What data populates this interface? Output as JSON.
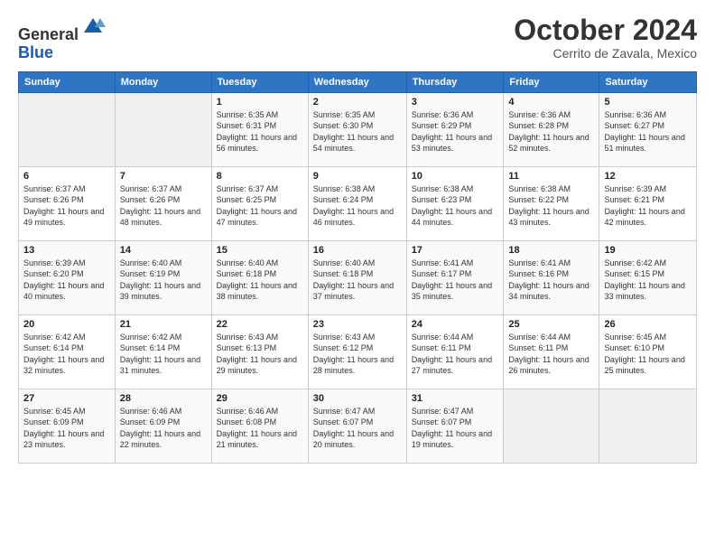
{
  "header": {
    "logo_line1": "General",
    "logo_line2": "Blue",
    "month": "October 2024",
    "location": "Cerrito de Zavala, Mexico"
  },
  "weekdays": [
    "Sunday",
    "Monday",
    "Tuesday",
    "Wednesday",
    "Thursday",
    "Friday",
    "Saturday"
  ],
  "weeks": [
    [
      {
        "day": "",
        "info": ""
      },
      {
        "day": "",
        "info": ""
      },
      {
        "day": "1",
        "info": "Sunrise: 6:35 AM\nSunset: 6:31 PM\nDaylight: 11 hours and 56 minutes."
      },
      {
        "day": "2",
        "info": "Sunrise: 6:35 AM\nSunset: 6:30 PM\nDaylight: 11 hours and 54 minutes."
      },
      {
        "day": "3",
        "info": "Sunrise: 6:36 AM\nSunset: 6:29 PM\nDaylight: 11 hours and 53 minutes."
      },
      {
        "day": "4",
        "info": "Sunrise: 6:36 AM\nSunset: 6:28 PM\nDaylight: 11 hours and 52 minutes."
      },
      {
        "day": "5",
        "info": "Sunrise: 6:36 AM\nSunset: 6:27 PM\nDaylight: 11 hours and 51 minutes."
      }
    ],
    [
      {
        "day": "6",
        "info": "Sunrise: 6:37 AM\nSunset: 6:26 PM\nDaylight: 11 hours and 49 minutes."
      },
      {
        "day": "7",
        "info": "Sunrise: 6:37 AM\nSunset: 6:26 PM\nDaylight: 11 hours and 48 minutes."
      },
      {
        "day": "8",
        "info": "Sunrise: 6:37 AM\nSunset: 6:25 PM\nDaylight: 11 hours and 47 minutes."
      },
      {
        "day": "9",
        "info": "Sunrise: 6:38 AM\nSunset: 6:24 PM\nDaylight: 11 hours and 46 minutes."
      },
      {
        "day": "10",
        "info": "Sunrise: 6:38 AM\nSunset: 6:23 PM\nDaylight: 11 hours and 44 minutes."
      },
      {
        "day": "11",
        "info": "Sunrise: 6:38 AM\nSunset: 6:22 PM\nDaylight: 11 hours and 43 minutes."
      },
      {
        "day": "12",
        "info": "Sunrise: 6:39 AM\nSunset: 6:21 PM\nDaylight: 11 hours and 42 minutes."
      }
    ],
    [
      {
        "day": "13",
        "info": "Sunrise: 6:39 AM\nSunset: 6:20 PM\nDaylight: 11 hours and 40 minutes."
      },
      {
        "day": "14",
        "info": "Sunrise: 6:40 AM\nSunset: 6:19 PM\nDaylight: 11 hours and 39 minutes."
      },
      {
        "day": "15",
        "info": "Sunrise: 6:40 AM\nSunset: 6:18 PM\nDaylight: 11 hours and 38 minutes."
      },
      {
        "day": "16",
        "info": "Sunrise: 6:40 AM\nSunset: 6:18 PM\nDaylight: 11 hours and 37 minutes."
      },
      {
        "day": "17",
        "info": "Sunrise: 6:41 AM\nSunset: 6:17 PM\nDaylight: 11 hours and 35 minutes."
      },
      {
        "day": "18",
        "info": "Sunrise: 6:41 AM\nSunset: 6:16 PM\nDaylight: 11 hours and 34 minutes."
      },
      {
        "day": "19",
        "info": "Sunrise: 6:42 AM\nSunset: 6:15 PM\nDaylight: 11 hours and 33 minutes."
      }
    ],
    [
      {
        "day": "20",
        "info": "Sunrise: 6:42 AM\nSunset: 6:14 PM\nDaylight: 11 hours and 32 minutes."
      },
      {
        "day": "21",
        "info": "Sunrise: 6:42 AM\nSunset: 6:14 PM\nDaylight: 11 hours and 31 minutes."
      },
      {
        "day": "22",
        "info": "Sunrise: 6:43 AM\nSunset: 6:13 PM\nDaylight: 11 hours and 29 minutes."
      },
      {
        "day": "23",
        "info": "Sunrise: 6:43 AM\nSunset: 6:12 PM\nDaylight: 11 hours and 28 minutes."
      },
      {
        "day": "24",
        "info": "Sunrise: 6:44 AM\nSunset: 6:11 PM\nDaylight: 11 hours and 27 minutes."
      },
      {
        "day": "25",
        "info": "Sunrise: 6:44 AM\nSunset: 6:11 PM\nDaylight: 11 hours and 26 minutes."
      },
      {
        "day": "26",
        "info": "Sunrise: 6:45 AM\nSunset: 6:10 PM\nDaylight: 11 hours and 25 minutes."
      }
    ],
    [
      {
        "day": "27",
        "info": "Sunrise: 6:45 AM\nSunset: 6:09 PM\nDaylight: 11 hours and 23 minutes."
      },
      {
        "day": "28",
        "info": "Sunrise: 6:46 AM\nSunset: 6:09 PM\nDaylight: 11 hours and 22 minutes."
      },
      {
        "day": "29",
        "info": "Sunrise: 6:46 AM\nSunset: 6:08 PM\nDaylight: 11 hours and 21 minutes."
      },
      {
        "day": "30",
        "info": "Sunrise: 6:47 AM\nSunset: 6:07 PM\nDaylight: 11 hours and 20 minutes."
      },
      {
        "day": "31",
        "info": "Sunrise: 6:47 AM\nSunset: 6:07 PM\nDaylight: 11 hours and 19 minutes."
      },
      {
        "day": "",
        "info": ""
      },
      {
        "day": "",
        "info": ""
      }
    ]
  ]
}
